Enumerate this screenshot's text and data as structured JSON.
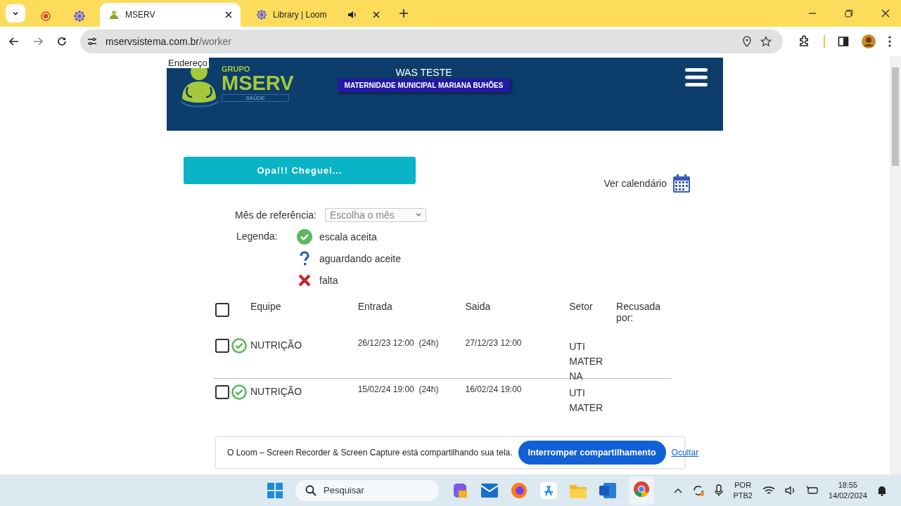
{
  "browser": {
    "tabs": [
      {
        "kind": "pinned-record",
        "selected": false
      },
      {
        "kind": "pinned-loom",
        "selected": false
      },
      {
        "kind": "page",
        "label": "MSERV",
        "selected": true
      },
      {
        "kind": "audio",
        "label": "Library | Loom",
        "selected": false
      }
    ],
    "url_host": "mservsistema.com.br",
    "url_path": "/worker"
  },
  "header": {
    "overlay_text": "Endereço",
    "logo_top": "GRUPO",
    "logo_main": "MSERV",
    "logo_sub": "SAÚDE",
    "user": "WAS TESTE",
    "unit": "MATERNIDADE MUNICIPAL MARIANA BUHÕES"
  },
  "arrive_button": "Opa!!! Cheguei...",
  "calendar_link": "Ver calendário",
  "month": {
    "label": "Mês de referência:",
    "placeholder": "Escolha o mês"
  },
  "legend": {
    "label": "Legenda:",
    "items": [
      {
        "kind": "accepted",
        "text": "escala aceita"
      },
      {
        "kind": "pending",
        "text": "aguardando aceite"
      },
      {
        "kind": "absent",
        "text": "falta"
      }
    ]
  },
  "table": {
    "select_all": {
      "checked": false
    },
    "columns": [
      "Equipe",
      "Entrada",
      "Saida",
      "Setor",
      "Recusada por:"
    ],
    "rows": [
      {
        "checked": false,
        "kind": "accepted",
        "team": "NUTRIÇÃO",
        "entrada": "26/12/23 12:00",
        "duration": "(24h)",
        "saida": "27/12/23 12:00",
        "setor": "UTI MATERNA"
      },
      {
        "checked": false,
        "kind": "accepted",
        "team": "NUTRIÇÃO",
        "entrada": "15/02/24 19:00",
        "duration": "(24h)",
        "saida": "16/02/24 19:00",
        "setor": "UTI MATER"
      }
    ]
  },
  "share_bar": {
    "message": "O Loom – Screen Recorder & Screen Capture está compartilhando sua tela.",
    "stop": "Interromper compartilhamento",
    "hide": "Ocultar"
  },
  "taskbar": {
    "search": "Pesquisar",
    "lang_top": "POR",
    "lang_bottom": "PTB2",
    "time": "18:55",
    "date": "14/02/2024"
  }
}
